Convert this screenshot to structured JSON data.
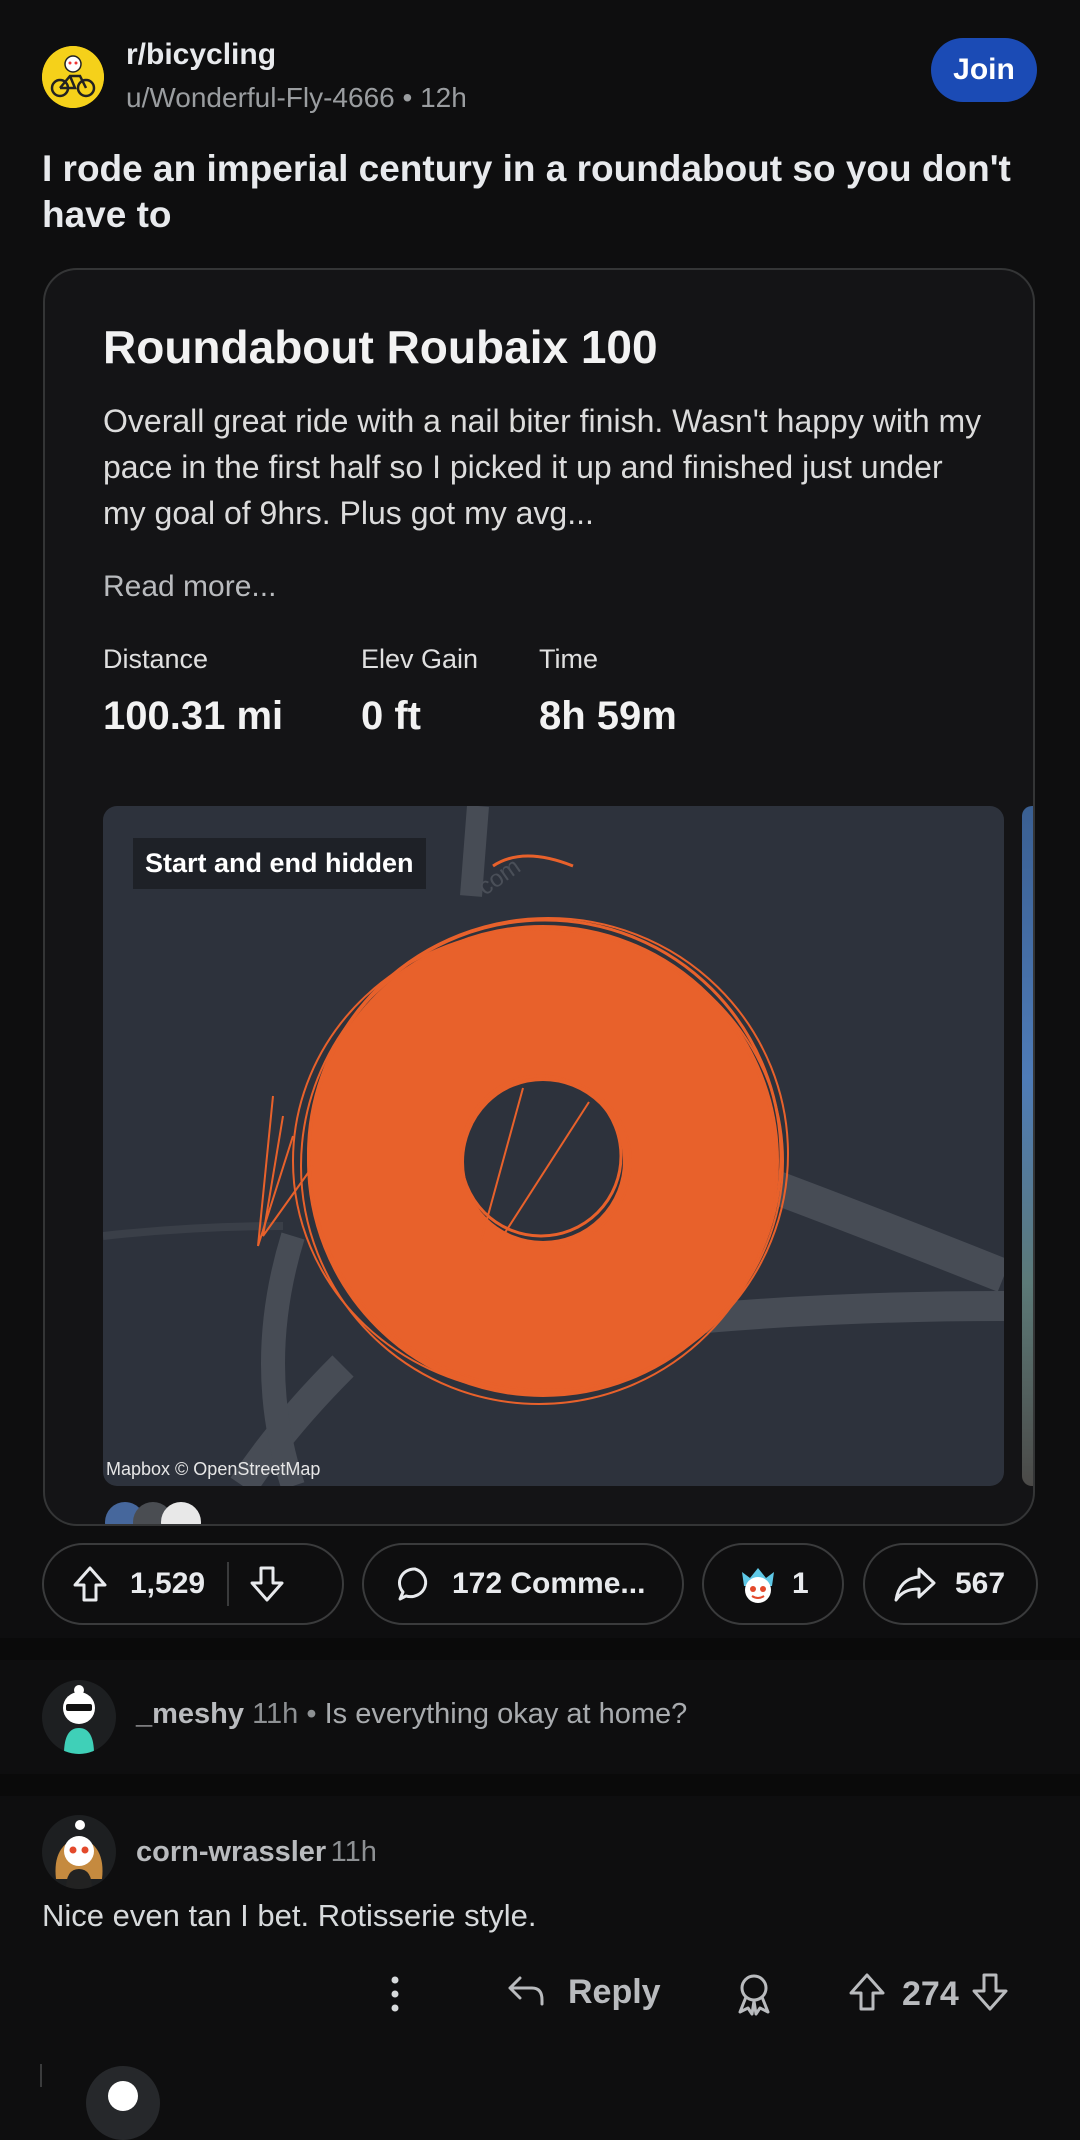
{
  "post": {
    "subreddit": "r/bicycling",
    "author": "u/Wonderful-Fly-4666",
    "age": "12h",
    "separator": "•",
    "join_label": "Join",
    "title": "I rode an imperial century in a roundabout so you don't have to"
  },
  "card": {
    "title": "Roundabout Roubaix 100",
    "description": "Overall great ride with a nail biter finish. Wasn't happy with my pace in the first half so I picked it up and finished just under my goal of 9hrs. Plus got my avg...",
    "read_more": "Read more...",
    "stats": [
      {
        "label": "Distance",
        "value": "100.31 mi"
      },
      {
        "label": "Elev Gain",
        "value": "0 ft"
      },
      {
        "label": "Time",
        "value": "8h 59m"
      }
    ],
    "map_badge": "Start and end hidden",
    "map_credit": "Mapbox © OpenStreetMap",
    "route_color": "#e8612b"
  },
  "actions": {
    "upvotes": "1,529",
    "comments": "172 Comme...",
    "awards": "1",
    "shares": "567"
  },
  "comments": [
    {
      "user": "_meshy",
      "age": "11h",
      "separator": "•",
      "text": "Is everything okay at home?"
    },
    {
      "user": "corn-wrassler",
      "age": "11h",
      "text": "Nice even tan I bet. Rotisserie style.",
      "reply_label": "Reply",
      "score": "274"
    }
  ],
  "icons": [
    "snoo-bicycle-icon",
    "upvote-icon",
    "downvote-icon",
    "comment-icon",
    "award-icon",
    "share-icon",
    "more-icon",
    "reply-icon"
  ]
}
